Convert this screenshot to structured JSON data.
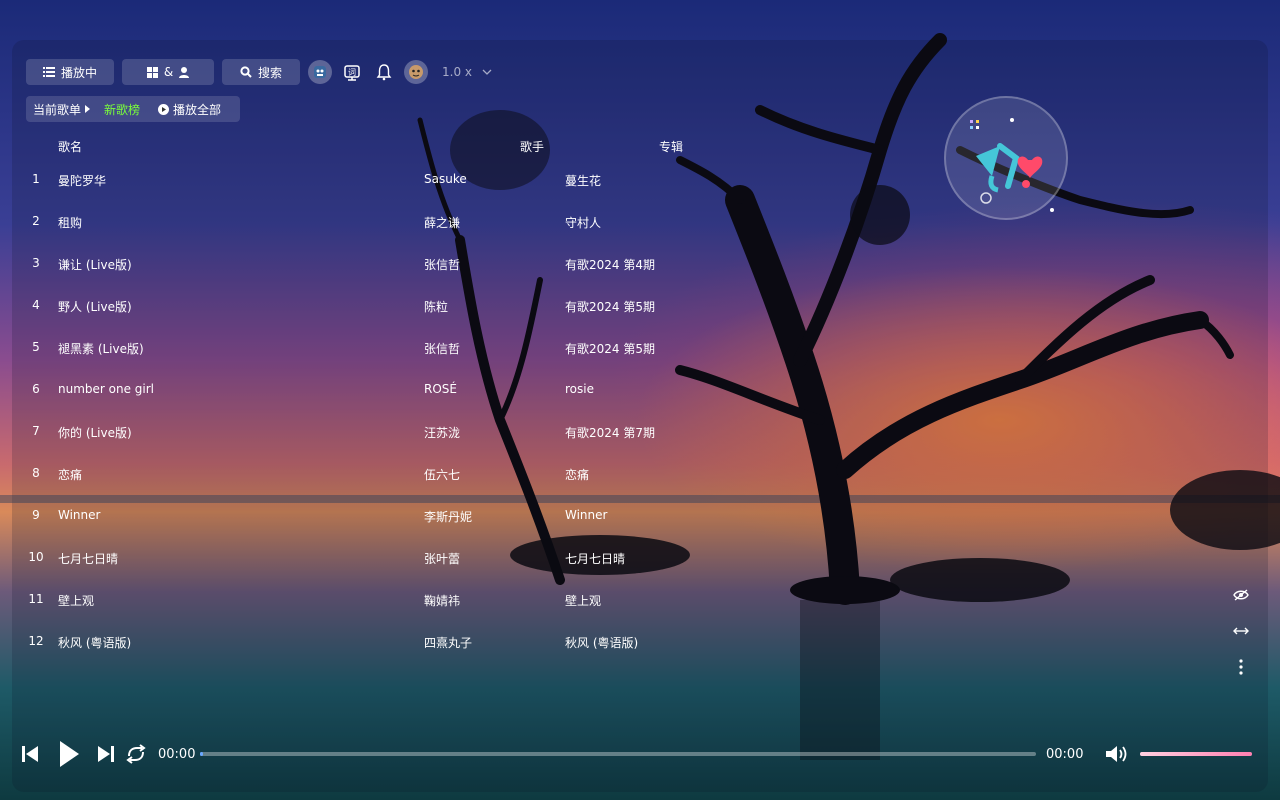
{
  "topbar": {
    "now_playing_label": "播放中",
    "lib_label": "&",
    "search_label": "搜索",
    "speed_label": "1.0 x"
  },
  "subbar": {
    "current_playlist_label": "当前歌单",
    "active_list": "新歌榜",
    "play_all_label": "播放全部"
  },
  "columns": {
    "name": "歌名",
    "artist": "歌手",
    "album": "专辑"
  },
  "songs": [
    {
      "idx": "1",
      "name": "曼陀罗华",
      "artist": "Sasuke",
      "album": "蔓生花"
    },
    {
      "idx": "2",
      "name": "租购",
      "artist": "薛之谦",
      "album": "守村人"
    },
    {
      "idx": "3",
      "name": "谦让 (Live版)",
      "artist": "张信哲",
      "album": "有歌2024 第4期"
    },
    {
      "idx": "4",
      "name": "野人 (Live版)",
      "artist": "陈粒",
      "album": "有歌2024 第5期"
    },
    {
      "idx": "5",
      "name": "褪黑素 (Live版)",
      "artist": "张信哲",
      "album": "有歌2024 第5期"
    },
    {
      "idx": "6",
      "name": "number one girl",
      "artist": "ROSÉ",
      "album": "rosie"
    },
    {
      "idx": "7",
      "name": "你的 (Live版)",
      "artist": "汪苏泷",
      "album": "有歌2024 第7期"
    },
    {
      "idx": "8",
      "name": "恋痛",
      "artist": "伍六七",
      "album": "恋痛"
    },
    {
      "idx": "9",
      "name": "Winner",
      "artist": "李斯丹妮",
      "album": "Winner"
    },
    {
      "idx": "10",
      "name": "七月七日晴",
      "artist": "张叶蕾",
      "album": "七月七日晴"
    },
    {
      "idx": "11",
      "name": "壁上观",
      "artist": "鞠婧祎",
      "album": "壁上观"
    },
    {
      "idx": "12",
      "name": "秋风 (粤语版)",
      "artist": "四熹丸子",
      "album": "秋风 (粤语版)"
    }
  ],
  "player": {
    "current_time": "00:00",
    "total_time": "00:00",
    "progress": 0.003,
    "volume": 1.0
  },
  "colors": {
    "active_tab": "#7bff3a",
    "progress_fill": "#6aa8ff",
    "volume_fill": "#ff7fb0"
  },
  "icons": [
    "list-icon",
    "grid-icon",
    "user-icon",
    "search-icon",
    "avatar-icon",
    "lyrics-icon",
    "bell-icon",
    "mascot-icon",
    "chevron-down-icon",
    "play-circle-icon",
    "eye-off-icon",
    "swap-horizontal-icon",
    "more-vertical-icon",
    "skip-previous-icon",
    "play-icon",
    "skip-next-icon",
    "repeat-icon",
    "volume-icon"
  ]
}
